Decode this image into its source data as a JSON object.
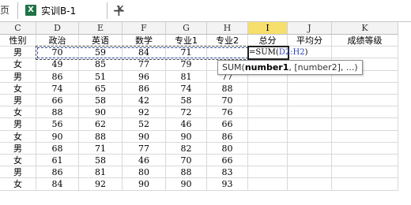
{
  "tabs": {
    "previous_tab_label": "页",
    "active_tab_title": "实训B-1",
    "excel_icon_glyph": "X",
    "close_glyph": "✕",
    "new_tab_glyph": "+"
  },
  "columns": [
    "C",
    "D",
    "E",
    "F",
    "G",
    "H",
    "I",
    "J",
    "K"
  ],
  "selected_column": "I",
  "headers": [
    "性别",
    "政治",
    "英语",
    "数学",
    "专业1",
    "专业2",
    "总分",
    "平均分",
    "成绩等级"
  ],
  "rows": [
    [
      "男",
      "70",
      "59",
      "84",
      "71",
      "",
      ""
    ],
    [
      "女",
      "49",
      "85",
      "77",
      "79",
      "",
      ""
    ],
    [
      "男",
      "86",
      "51",
      "96",
      "81",
      "77",
      ""
    ],
    [
      "女",
      "74",
      "65",
      "86",
      "74",
      "88",
      ""
    ],
    [
      "男",
      "66",
      "58",
      "42",
      "58",
      "70",
      ""
    ],
    [
      "女",
      "88",
      "90",
      "92",
      "72",
      "76",
      ""
    ],
    [
      "男",
      "56",
      "62",
      "52",
      "46",
      "66",
      ""
    ],
    [
      "女",
      "90",
      "88",
      "90",
      "90",
      "86",
      ""
    ],
    [
      "男",
      "68",
      "71",
      "77",
      "82",
      "80",
      ""
    ],
    [
      "女",
      "61",
      "58",
      "46",
      "70",
      "66",
      ""
    ],
    [
      "男",
      "86",
      "81",
      "80",
      "88",
      "83",
      ""
    ],
    [
      "女",
      "84",
      "92",
      "90",
      "90",
      "93",
      ""
    ]
  ],
  "active_formula": {
    "prefix": "=SUM(",
    "range_ref": "D2:H2",
    "suffix": ")"
  },
  "tooltip": {
    "fn": "SUM(",
    "arg1": "number1",
    "rest": ", [number2], ...)"
  },
  "colors": {
    "selected_column_header": "#f7df6d",
    "reference_color": "#2b3fbf",
    "excel_green": "#1f7244"
  }
}
